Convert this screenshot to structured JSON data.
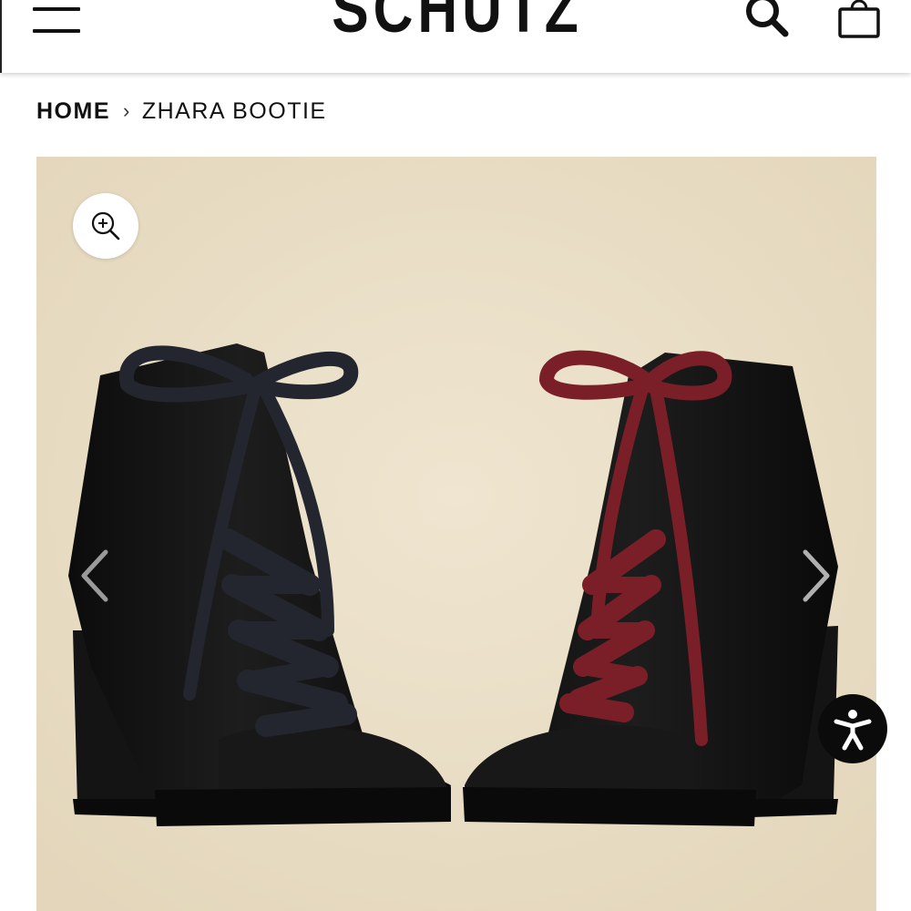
{
  "header": {
    "brand": "SCHUTZ",
    "menu_icon": "hamburger-menu-icon",
    "search_icon": "search-icon",
    "bag_icon": "shopping-bag-icon"
  },
  "breadcrumb": {
    "home": "HOME",
    "separator": "›",
    "current": "ZHARA BOOTIE"
  },
  "gallery": {
    "zoom_icon": "zoom-in-icon",
    "prev_icon": "chevron-left-icon",
    "next_icon": "chevron-right-icon",
    "background_color": "#e9dec7",
    "left_boot_lace_color": "#1c1f27",
    "right_boot_lace_color": "#7a1f28"
  },
  "accessibility": {
    "icon": "accessibility-person-icon",
    "color": "#0b0b0b"
  }
}
